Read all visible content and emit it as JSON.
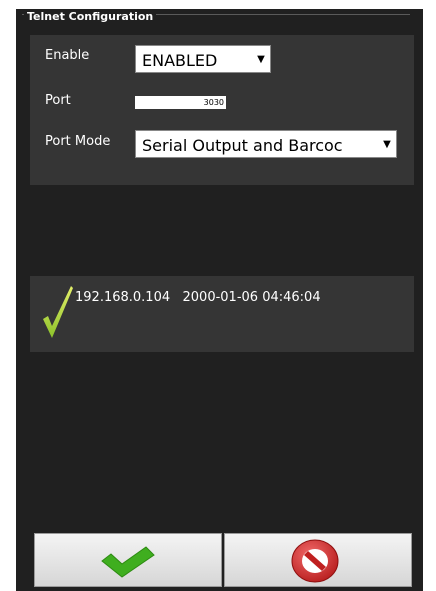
{
  "telnet": {
    "legend": "Telnet Configuration",
    "enable": {
      "label": "Enable",
      "value": "ENABLED"
    },
    "port": {
      "label": "Port",
      "value": "3030"
    },
    "port_mode": {
      "label": "Port Mode",
      "value": "Serial Output and Barcoc"
    }
  },
  "status": {
    "icon": "checkmark-icon",
    "ip": "192.168.0.104",
    "timestamp": "2000-01-06 04:46:04"
  },
  "buttons": {
    "ok_icon": "checkmark-icon",
    "cancel_icon": "cancel-icon"
  },
  "colors": {
    "panel": "#202020",
    "inner_box": "#353535",
    "check_green": "#3fae1f",
    "cancel_red": "#d12a2a"
  }
}
